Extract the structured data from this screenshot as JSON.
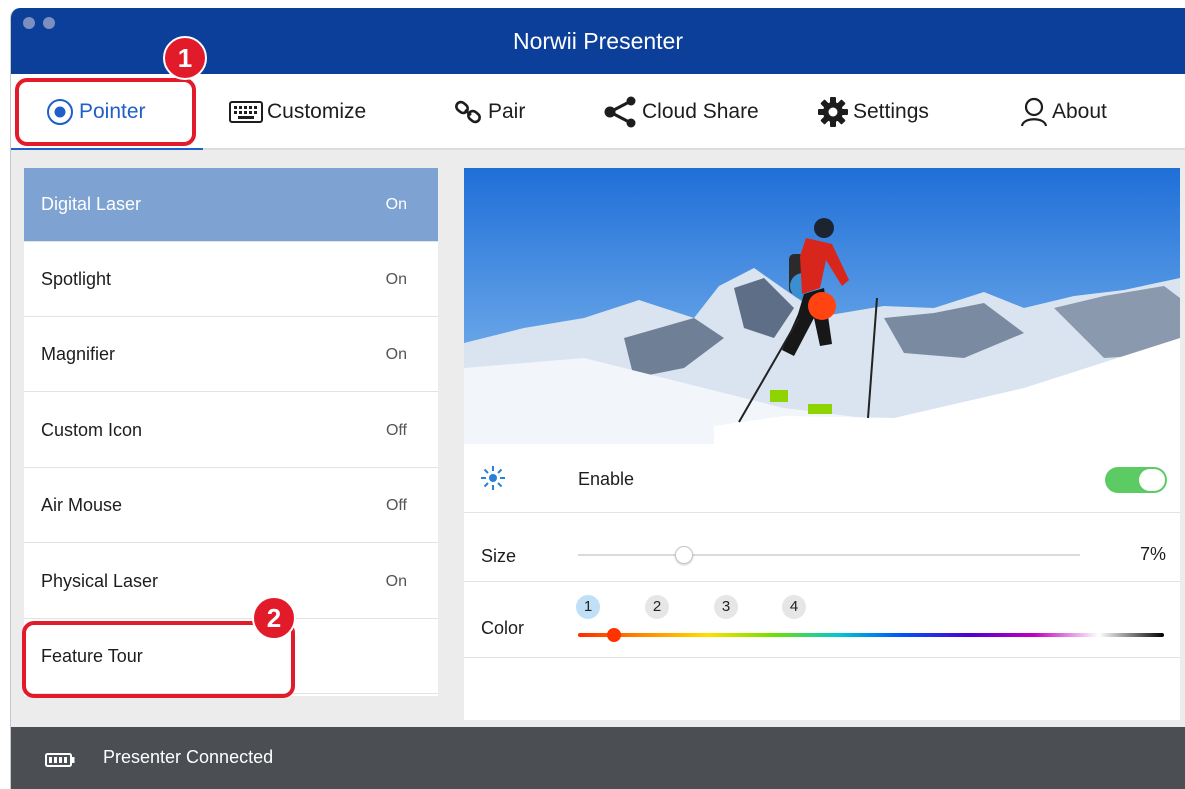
{
  "window": {
    "title": "Norwii Presenter"
  },
  "tabs": [
    {
      "label": "Pointer",
      "icon": "radio-dot-icon",
      "active": true
    },
    {
      "label": "Customize",
      "icon": "keyboard-icon"
    },
    {
      "label": "Pair",
      "icon": "link-icon"
    },
    {
      "label": "Cloud Share",
      "icon": "share-icon"
    },
    {
      "label": "Settings",
      "icon": "gear-icon"
    },
    {
      "label": "About",
      "icon": "person-icon"
    }
  ],
  "sidebar": {
    "items": [
      {
        "label": "Digital Laser",
        "value": "On",
        "selected": true
      },
      {
        "label": "Spotlight",
        "value": "On"
      },
      {
        "label": "Magnifier",
        "value": "On"
      },
      {
        "label": "Custom Icon",
        "value": "Off"
      },
      {
        "label": "Air Mouse",
        "value": "Off"
      },
      {
        "label": "Physical Laser",
        "value": "On"
      },
      {
        "label": "Feature Tour",
        "value": ""
      }
    ]
  },
  "panel": {
    "preview_image": "mountain skier photo with red laser dot",
    "enable": {
      "icon": "sun-icon",
      "label": "Enable",
      "on": true
    },
    "size": {
      "label": "Size",
      "value_text": "7%",
      "value": 0.07
    },
    "color": {
      "label": "Color",
      "options": [
        "1",
        "2",
        "3",
        "4"
      ],
      "selected": "1",
      "slider_color": "#ff3300"
    }
  },
  "status": {
    "icon": "battery-icon",
    "text": "Presenter Connected"
  },
  "callouts": [
    {
      "number": "1",
      "target": "Pointer tab"
    },
    {
      "number": "2",
      "target": "Feature Tour"
    }
  ],
  "colors": {
    "titlebar": "#0c3f9a",
    "accent": "#1f5fc7",
    "selected_row": "#7ea2d1",
    "toggle_on": "#5ccb64",
    "callout": "#e21b2b",
    "statusbar": "#4b4e53"
  }
}
